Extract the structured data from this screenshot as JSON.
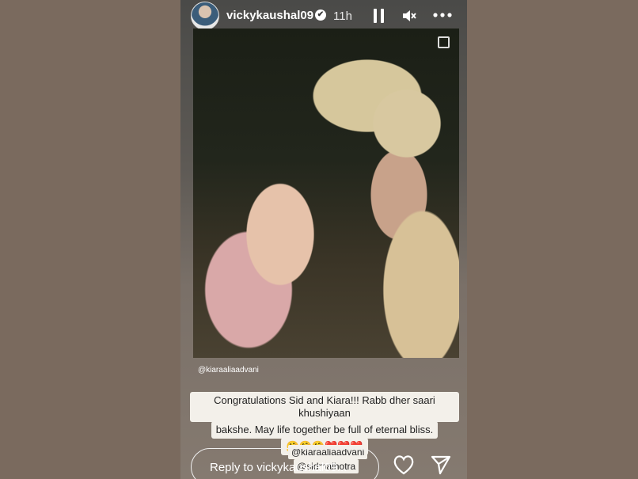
{
  "header": {
    "username": "vickykaushal09",
    "verified_mark": "✔",
    "time": "11h",
    "icons": [
      "avatar",
      "verified-icon",
      "pause-icon",
      "mute-icon",
      "more-icon"
    ]
  },
  "story": {
    "tag": "@kiaraaliaadvani",
    "caption_line1": "Congratulations Sid and Kiara!!! Rabb dher saari khushiyaan",
    "caption_line2": "bakshe. May life together be full of eternal bliss.",
    "emojis": "🤗🤗🤗❤️❤️❤️",
    "mention1": "@kiaraaliaadvani",
    "mention2": "@sidmalhotra"
  },
  "footer": {
    "reply_placeholder": "Reply to vickykaushal09...",
    "icons": [
      "heart-icon",
      "send-icon"
    ]
  },
  "colors": {
    "page_bg": "#7a6a5e",
    "caption_bg": "#f3f0ea",
    "text_white": "#ffffff"
  }
}
